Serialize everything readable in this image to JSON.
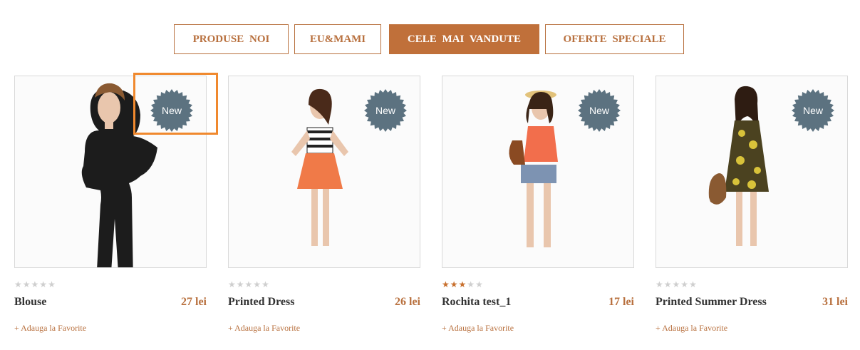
{
  "tabs": [
    {
      "label": "PRODUSE  NOI",
      "active": false
    },
    {
      "label": "EU&MAMI",
      "active": false
    },
    {
      "label": "CELE MAI  VANDUTE",
      "active": true
    },
    {
      "label": "OFERTE  SPECIALE",
      "active": false
    }
  ],
  "products": [
    {
      "name": "Blouse",
      "price": "27 lei",
      "rating": 0,
      "badge": "New",
      "favorite": "+ Adauga la Favorite",
      "outfit": "black-blouse"
    },
    {
      "name": "Printed Dress",
      "price": "26 lei",
      "rating": 0,
      "badge": "New",
      "favorite": "+ Adauga la Favorite",
      "outfit": "striped-top-orange-skirt"
    },
    {
      "name": "Rochita test_1",
      "price": "17 lei",
      "rating": 3,
      "badge": "New",
      "favorite": "+ Adauga la Favorite",
      "outfit": "coral-top-denim-shorts"
    },
    {
      "name": "Printed Summer Dress",
      "price": "31 lei",
      "rating": 0,
      "badge": "New",
      "favorite": "+ Adauga la Favorite",
      "outfit": "yellow-floral-dress"
    }
  ],
  "colors": {
    "accent": "#c0703a",
    "badge": "#5c7280",
    "highlight": "#f0892e"
  }
}
